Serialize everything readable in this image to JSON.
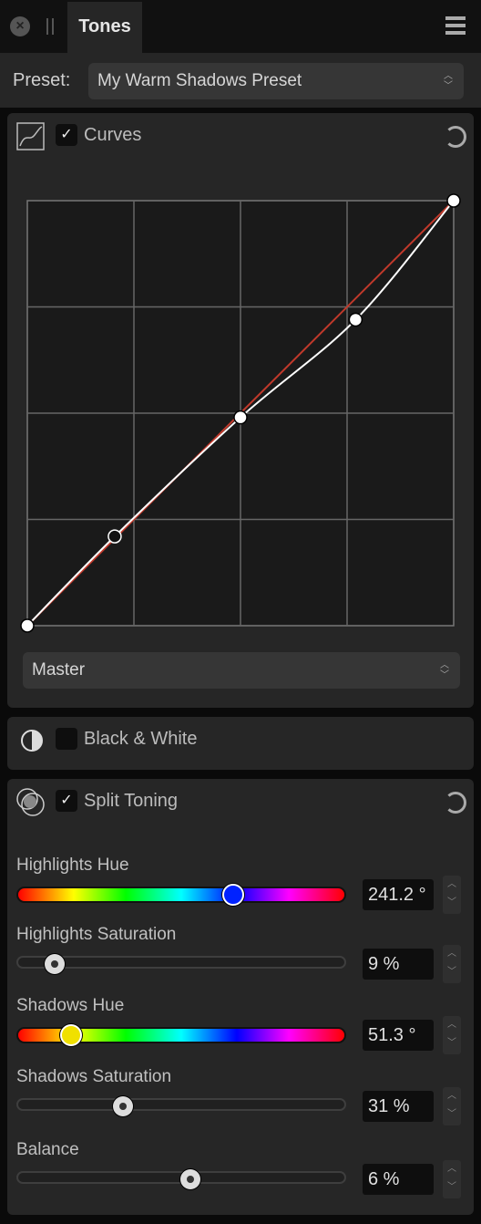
{
  "window": {
    "tab_label": "Tones",
    "close_icon": "close-icon",
    "grip_icon": "grip-icon",
    "menu_icon": "hamburger-menu-icon"
  },
  "preset": {
    "label": "Preset:",
    "value": "My Warm Shadows Preset"
  },
  "curves": {
    "title": "Curves",
    "enabled": true,
    "icon": "curve-graph-icon",
    "reset_icon": "reset-icon",
    "channel": "Master",
    "points": [
      [
        0,
        0
      ],
      [
        0.205,
        0.21
      ],
      [
        0.5,
        0.49
      ],
      [
        0.77,
        0.72
      ],
      [
        1,
        1
      ]
    ],
    "reference_color": "#c0392b"
  },
  "bw": {
    "title": "Black & White",
    "enabled": false,
    "icon": "half-circle-icon"
  },
  "split": {
    "title": "Split Toning",
    "enabled": true,
    "icon": "split-toning-icon",
    "reset_icon": "reset-icon",
    "sliders": [
      {
        "label": "Highlights Hue",
        "value": "241.2 °",
        "fraction": 0.67,
        "kind": "hue",
        "thumb_color": "#0022ff"
      },
      {
        "label": "Highlights Saturation",
        "value": "9 %",
        "fraction": 0.09,
        "kind": "gray"
      },
      {
        "label": "Shadows Hue",
        "value": "51.3 °",
        "fraction": 0.1425,
        "kind": "hue",
        "thumb_color": "#f0e000"
      },
      {
        "label": "Shadows Saturation",
        "value": "31 %",
        "fraction": 0.31,
        "kind": "gray"
      },
      {
        "label": "Balance",
        "value": "6 %",
        "fraction": 0.53,
        "kind": "gray"
      }
    ]
  }
}
